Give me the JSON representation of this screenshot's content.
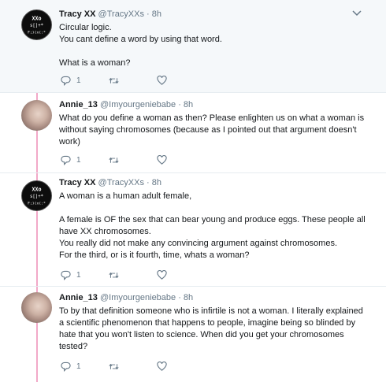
{
  "tweets": [
    {
      "name": "Tracy XX",
      "handle": "@TracyXXs · 8h",
      "avatar": "xx-logo-avatar",
      "avatar_text": [
        "XXo",
        "s[]+*",
        "F;)(x(:*"
      ],
      "lines": [
        "Circular logic.",
        "You cant define a word by using that word.",
        "",
        "What is a woman?"
      ],
      "reply_count": "1"
    },
    {
      "name": "Annie_13",
      "handle": "@Imyourgeniebabe · 8h",
      "avatar": "photo-avatar",
      "lines": [
        "What do you define a woman as then? Please enlighten us on what a woman is",
        "without saying chromosomes (because as I pointed out that argument doesn't",
        "work)"
      ],
      "reply_count": "1"
    },
    {
      "name": "Tracy XX",
      "handle": "@TracyXXs · 8h",
      "avatar": "xx-logo-avatar",
      "avatar_text": [
        "XXo",
        "s[]+*",
        "F;)(x(:*"
      ],
      "lines": [
        "A woman is a human adult female,",
        "",
        "A female is OF the sex that can bear young and produce eggs. These people all",
        "have XX chromosomes.",
        "You really did not make any convincing argument against chromosomes.",
        "For the third, or is it fourth, time,  whats a woman?"
      ],
      "reply_count": "1"
    },
    {
      "name": "Annie_13",
      "handle": "@Imyourgeniebabe · 8h",
      "avatar": "photo-avatar",
      "lines": [
        "To by that definition someone who is infirtile is not a woman. I literally explained",
        "a scientific phenomenon that happens to people, imagine being so blinded by",
        "hate that you won't listen to science. When did you get your chromosomes",
        "tested?"
      ],
      "reply_count": "1"
    }
  ],
  "colors": {
    "thread_line": "#f2a9c8",
    "highlight_bg": "#f5f8fa",
    "text": "#14171a",
    "muted": "#657786"
  },
  "icons": [
    "chevron-down-icon",
    "reply-icon",
    "retweet-icon",
    "like-icon"
  ]
}
